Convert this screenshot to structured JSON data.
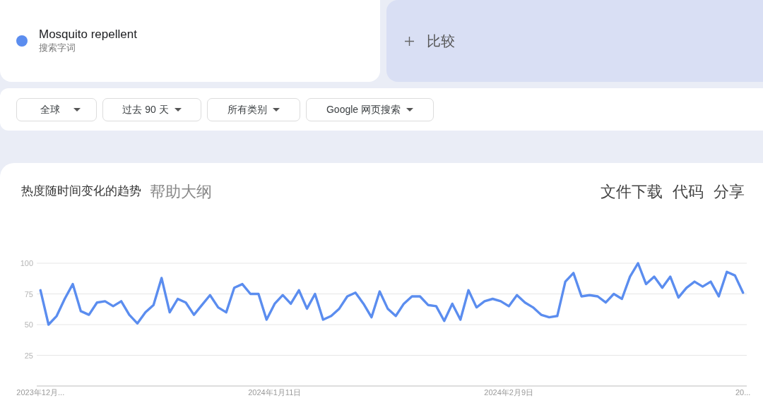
{
  "search_terms": [
    {
      "term": "Mosquito repellent",
      "subtitle": "搜索字词",
      "color": "#5b8def"
    }
  ],
  "compare": {
    "label": "比较"
  },
  "filters": [
    {
      "label": "全球"
    },
    {
      "label": "过去 90 天"
    },
    {
      "label": "所有类别"
    },
    {
      "label": "Google 网页搜索"
    }
  ],
  "trend_panel": {
    "title": "热度随时间变化的趋势",
    "help": "帮助大纲",
    "actions": [
      "文件下载",
      "代码",
      "分享"
    ],
    "chart_data": {
      "type": "line",
      "categories": [
        "2023年12月...",
        null,
        null,
        null,
        null,
        null,
        null,
        null,
        null,
        null,
        null,
        null,
        null,
        null,
        null,
        null,
        null,
        null,
        null,
        null,
        null,
        null,
        null,
        null,
        null,
        null,
        null,
        null,
        null,
        "2024年1月11日",
        null,
        null,
        null,
        null,
        null,
        null,
        null,
        null,
        null,
        null,
        null,
        null,
        null,
        null,
        null,
        null,
        null,
        null,
        null,
        null,
        null,
        null,
        null,
        null,
        null,
        null,
        null,
        null,
        "2024年2月9日",
        null,
        null,
        null,
        null,
        null,
        null,
        null,
        null,
        null,
        null,
        null,
        null,
        null,
        null,
        null,
        null,
        null,
        null,
        null,
        null,
        null,
        null,
        null,
        null,
        null,
        null,
        null,
        null,
        "20..."
      ],
      "series": [
        {
          "color": "#5b8def",
          "values": [
            78,
            50,
            57,
            71,
            83,
            61,
            58,
            68,
            69,
            65,
            69,
            58,
            51,
            60,
            66,
            88,
            60,
            71,
            68,
            58,
            66,
            74,
            64,
            60,
            80,
            83,
            75,
            75,
            54,
            67,
            74,
            67,
            78,
            63,
            75,
            54,
            57,
            63,
            73,
            76,
            67,
            56,
            77,
            63,
            57,
            67,
            73,
            73,
            66,
            65,
            53,
            67,
            54,
            78,
            64,
            69,
            71,
            69,
            65,
            74,
            68,
            64,
            58,
            56,
            57,
            85,
            92,
            73,
            74,
            73,
            68,
            75,
            71,
            89,
            100,
            83,
            89,
            80,
            89,
            72,
            80,
            85,
            81,
            85,
            73,
            93,
            90,
            76
          ]
        }
      ],
      "ylim": [
        0,
        100
      ],
      "yticks": [
        25,
        50,
        75,
        100
      ],
      "grid": true
    }
  }
}
